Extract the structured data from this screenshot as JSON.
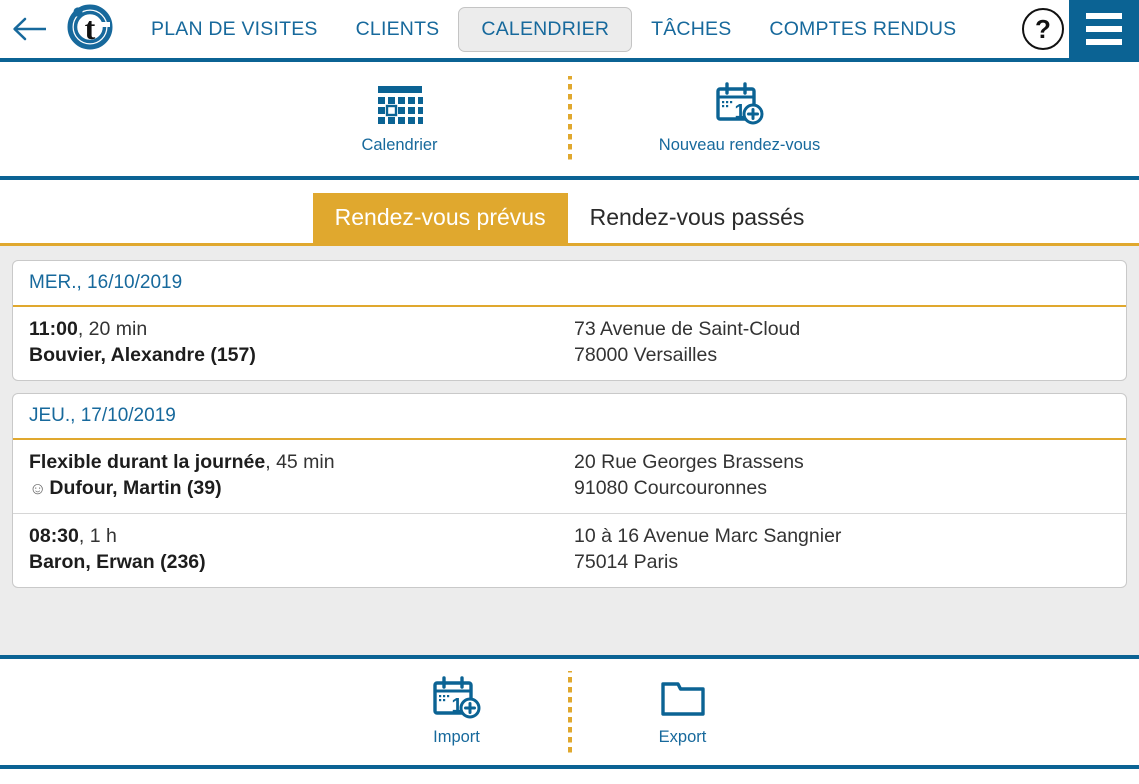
{
  "header": {
    "back_icon": "back-arrow-icon",
    "logo": "t-brand-logo",
    "nav_items": [
      {
        "label": "PLAN DE VISITES",
        "selected": false
      },
      {
        "label": "CLIENTS",
        "selected": false
      },
      {
        "label": "CALENDRIER",
        "selected": true
      },
      {
        "label": "TÂCHES",
        "selected": false
      },
      {
        "label": "COMPTES RENDUS",
        "selected": false
      }
    ],
    "help_label": "?",
    "menu_icon": "hamburger-menu-icon"
  },
  "actionbar": {
    "buttons": [
      {
        "label": "Calendrier",
        "icon": "calendar-grid-icon"
      },
      {
        "label": "Nouveau rendez-vous",
        "icon": "calendar-add-icon"
      }
    ]
  },
  "tabs": [
    {
      "label": "Rendez-vous prévus",
      "active": true
    },
    {
      "label": "Rendez-vous passés",
      "active": false
    }
  ],
  "days": [
    {
      "date_label": "MER., 16/10/2019",
      "appointments": [
        {
          "time": "11:00",
          "duration": "20 min",
          "smiley": false,
          "client": "Bouvier, Alexandre (157)",
          "address_line1": "73 Avenue de Saint-Cloud",
          "address_line2": "78000 Versailles"
        }
      ]
    },
    {
      "date_label": "JEU., 17/10/2019",
      "appointments": [
        {
          "time": "Flexible durant la journée",
          "duration": "45 min",
          "smiley": true,
          "client": "Dufour, Martin (39)",
          "address_line1": "20 Rue Georges Brassens",
          "address_line2": "91080 Courcouronnes"
        },
        {
          "time": "08:30",
          "duration": "1 h",
          "smiley": false,
          "client": "Baron, Erwan (236)",
          "address_line1": "10 à 16 Avenue Marc Sangnier",
          "address_line2": "75014 Paris"
        }
      ]
    }
  ],
  "footer": {
    "buttons": [
      {
        "label": "Import",
        "icon": "calendar-add-icon"
      },
      {
        "label": "Export",
        "icon": "folder-icon"
      }
    ]
  },
  "colors": {
    "brand_blue": "#0b6394",
    "link_blue": "#17699c",
    "accent_gold": "#e0a82e",
    "page_bg": "#ececec",
    "card_bg": "#ffffff"
  }
}
